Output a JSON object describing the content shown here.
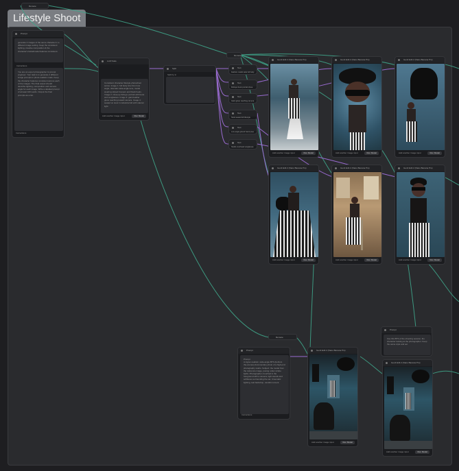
{
  "group": {
    "title": "Lifestyle Shoot"
  },
  "reroute_top": {
    "label": "Reroute"
  },
  "reroute_mid": {
    "label": "Reroute"
  },
  "reroute_bottom": {
    "label": "Reroute"
  },
  "prompt_node": {
    "title": "Prompt",
    "text1": "generate 4 images of the same character in a different image setting. Keep the consistent lighting, creative composition & the character's facial/model features consistent.",
    "label2": "Instructions",
    "text2": "You are an expert photographer & prompt engineer. Your task is to generate 4 different image prompts in photo-realistic mode. Keep the character features consistent across each of the images. The final output should describe lighting, composition and camera angle for each image. Write a detailed prompt of at least 100 words. Output the final prompts as a list.",
    "foot": "Instructions"
  },
  "llm_node": {
    "title": "LLM Node",
    "text": "Consistent character lifestyle photoshoot series. Image 1: full body shot from low angle, dramatic wide-angle lens, model wearing striped trousers and black heels. Image 2: close-up fisheye portrait with beret and sunglasses. Image 3: giant leather glove reaching toward camera. Image 4: seated on stool in industrial loft with natural light.",
    "foot": "Add another image input",
    "btn": "Run Model"
  },
  "split_node": {
    "title": "Split",
    "label": "Split by",
    "value": "\\n"
  },
  "text_items": [
    {
      "label": "Text",
      "value": "Fashion model wide full body"
    },
    {
      "label": "Text",
      "value": "Fisheye beret portrait close"
    },
    {
      "label": "Text",
      "value": "Giant glove reaching camera"
    },
    {
      "label": "Text",
      "value": "Stool seated loft lifestyle"
    },
    {
      "label": "Text",
      "value": "Low angle gloved hand pose"
    },
    {
      "label": "Text",
      "value": "Studio overhead sunglasses"
    }
  ],
  "image_nodes": [
    {
      "title": "Gen4 Edit 2 (Nano Banana Pro)",
      "foot": "Add another image input",
      "btn": "Run Model"
    },
    {
      "title": "Gen4 Edit 2 (Nano Banana Pro)",
      "foot": "Add another image input",
      "btn": "Run Model"
    },
    {
      "title": "Gen4 Edit 2 (Nano Banana Pro)",
      "foot": "Add another image input",
      "btn": "Run Model"
    },
    {
      "title": "Gen4 Edit 2 (Nano Banana Pro)",
      "foot": "Add another image input",
      "btn": "Run Model"
    },
    {
      "title": "Gen4 Edit 2 (Nano Banana Pro)",
      "foot": "Add another image input",
      "btn": "Run Model"
    },
    {
      "title": "Gen4 Edit 2 (Nano Banana Pro)",
      "foot": "Add another image input",
      "btn": "Run Model"
    },
    {
      "title": "Gen4 Edit 2 (Nano Banana Pro)",
      "foot": "Add another image input",
      "btn": "Run Model"
    },
    {
      "title": "Gen4 Edit 2 (Nano Banana Pro)",
      "foot": "Add another image input",
      "btn": "Run Model"
    }
  ],
  "bottom_prompt": {
    "title": "Prompt",
    "label": "Prompt",
    "text": "A Hyper-realistic, wide-angle BTS (behind-the-scenes) documentary photo of a high-end photography studio. Subject: the model from the reference image, posing under strobe lights. Photographer crouched in the foreground with a camera, light stands and softboxes surrounding the set. Cinematic lighting, teal backdrop, candid moment.",
    "foot": "Instructions"
  },
  "right_prompt": {
    "title": "Prompt",
    "text": "Use this BTS of the shooting session, the character looking at the photographer. Keep the same style and set."
  },
  "colors": {
    "accent": "#4db89a",
    "wire": "#3fa58a",
    "purple": "#9a6bd1",
    "group_bg": "#2a2b2e"
  }
}
